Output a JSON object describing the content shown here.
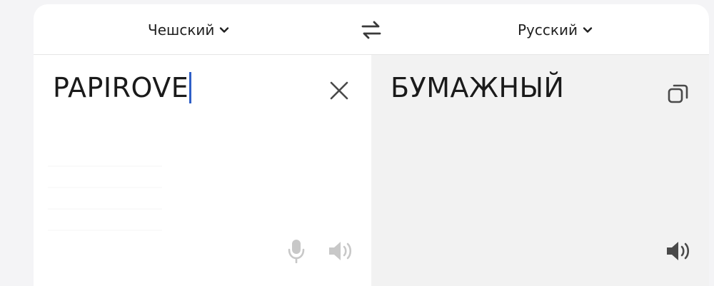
{
  "languages": {
    "source": "Чешский",
    "target": "Русский"
  },
  "source": {
    "text": "PAPIROVE"
  },
  "target": {
    "text": "БУМАЖНЫЙ"
  },
  "icons": {
    "chevron": "chevron-down-icon",
    "swap": "swap-arrows-icon",
    "clear": "close-icon",
    "copy": "copy-icon",
    "mic": "microphone-icon",
    "speaker": "speaker-icon"
  },
  "colors": {
    "caret": "#2f5fc7",
    "target_background": "#f2f2f2",
    "icon_dim": "#c8c8c8",
    "icon_dark": "#4a4a4a"
  }
}
